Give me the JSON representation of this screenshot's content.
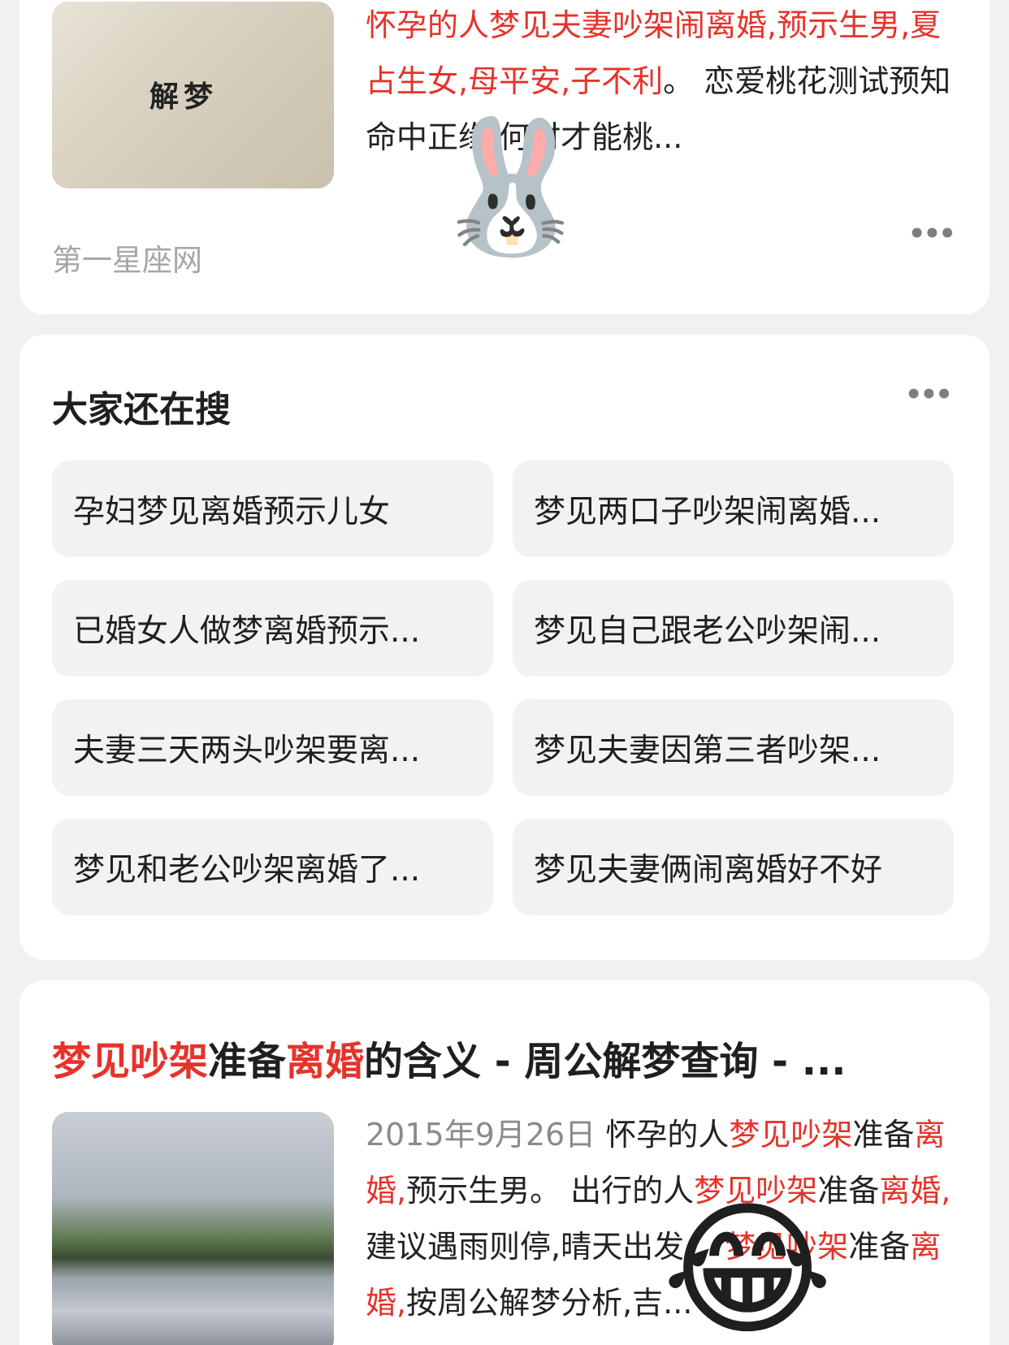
{
  "result1": {
    "thumb_caption": "解梦",
    "desc_parts": [
      {
        "text": "怀孕的人梦见夫妻吵架闹离婚,预示生男,夏占生女,母平安,子不利",
        "hl": true
      },
      {
        "text": "。 恋爱桃花测试预知命中正缘,何时才能桃...",
        "hl": false
      }
    ],
    "source": "第一星座网",
    "more": "•••"
  },
  "related": {
    "title": "大家还在搜",
    "more": "•••",
    "items": [
      "孕妇梦见离婚预示儿女",
      "梦见两口子吵架闹离婚...",
      "已婚女人做梦离婚预示...",
      "梦见自己跟老公吵架闹...",
      "夫妻三天两头吵架要离...",
      "梦见夫妻因第三者吵架...",
      "梦见和老公吵架离婚了...",
      "梦见夫妻俩闹离婚好不好"
    ]
  },
  "result2": {
    "title_parts": [
      {
        "text": "梦见吵架",
        "hl": true
      },
      {
        "text": "准备",
        "hl": false
      },
      {
        "text": "离婚",
        "hl": true
      },
      {
        "text": "的含义 - 周公解梦查询 - ...",
        "hl": false
      }
    ],
    "date": "2015年9月26日",
    "desc_parts": [
      {
        "text": " 怀孕的人",
        "hl": false
      },
      {
        "text": "梦见吵架",
        "hl": true
      },
      {
        "text": "准备",
        "hl": false
      },
      {
        "text": "离婚,",
        "hl": true
      },
      {
        "text": "预示生男。 出行的人",
        "hl": false
      },
      {
        "text": "梦见吵架",
        "hl": true
      },
      {
        "text": "准备",
        "hl": false
      },
      {
        "text": "离婚,",
        "hl": true
      },
      {
        "text": "建议遇雨则停,晴天出发。 ",
        "hl": false
      },
      {
        "text": "梦见吵架",
        "hl": true
      },
      {
        "text": "准备",
        "hl": false
      },
      {
        "text": "离婚,",
        "hl": true
      },
      {
        "text": "按周公解梦分析,吉...",
        "hl": false
      }
    ]
  },
  "stickers": {
    "rabbit": "🐰",
    "laugh": "😂"
  }
}
